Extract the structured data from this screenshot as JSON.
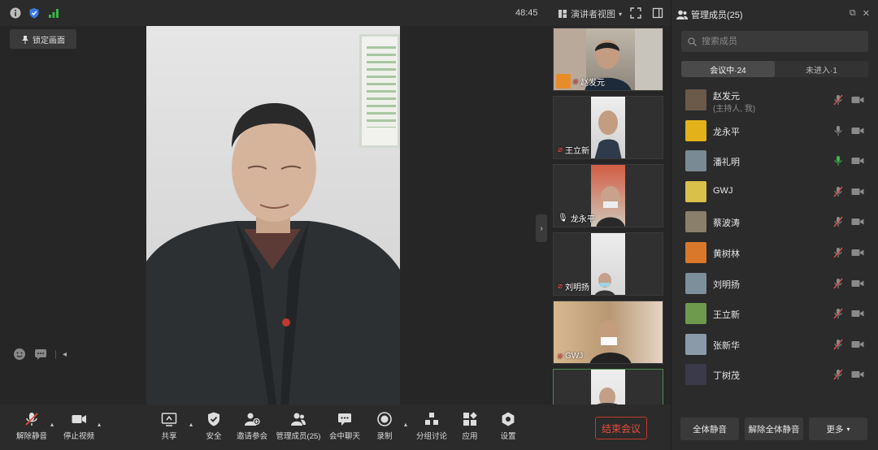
{
  "topbar": {
    "timer": "48:45",
    "view_mode": "演讲者视图",
    "lock_label": "锁定画面"
  },
  "thumbnails": [
    {
      "name": "赵发元",
      "muted": true,
      "host": true
    },
    {
      "name": "王立新",
      "muted": true
    },
    {
      "name": "龙永平",
      "muted": false
    },
    {
      "name": "刘明扬",
      "muted": true
    },
    {
      "name": "GWJ",
      "muted": true
    },
    {
      "name": "",
      "muted": false
    }
  ],
  "panel": {
    "title": "管理成员(25)",
    "search_placeholder": "搜索成员",
    "tab_in": "会议中·24",
    "tab_out": "未进入·1",
    "members": [
      {
        "name": "赵发元",
        "sub": "(主持人, 我)",
        "mic": "muted",
        "avatar_color": "#6b5a4a"
      },
      {
        "name": "龙永平",
        "sub": "",
        "mic": "on",
        "avatar_color": "#e3b21a"
      },
      {
        "name": "潘礼明",
        "sub": "",
        "mic": "speaking",
        "avatar_color": "#7a8a94"
      },
      {
        "name": "GWJ",
        "sub": "",
        "mic": "muted",
        "avatar_color": "#d9c04a"
      },
      {
        "name": "蔡波涛",
        "sub": "",
        "mic": "muted",
        "avatar_color": "#8a7f6a"
      },
      {
        "name": "黄树林",
        "sub": "",
        "mic": "muted",
        "avatar_color": "#d9782a"
      },
      {
        "name": "刘明扬",
        "sub": "",
        "mic": "muted",
        "avatar_color": "#7d8f9a"
      },
      {
        "name": "王立新",
        "sub": "",
        "mic": "muted",
        "avatar_color": "#6e9a4e"
      },
      {
        "name": "张新华",
        "sub": "",
        "mic": "muted",
        "avatar_color": "#8a9aa8"
      },
      {
        "name": "丁树茂",
        "sub": "",
        "mic": "muted",
        "avatar_color": "#3a3a4a"
      }
    ],
    "btn_mute_all": "全体静音",
    "btn_unmute_all": "解除全体静音",
    "btn_more": "更多"
  },
  "toolbar": {
    "unmute": "解除静音",
    "stop_video": "停止视频",
    "share": "共享",
    "security": "安全",
    "invite": "邀请参会",
    "manage": "管理成员(25)",
    "chat": "会中聊天",
    "record": "录制",
    "breakout": "分组讨论",
    "apps": "应用",
    "settings": "设置",
    "end": "结束会议"
  }
}
